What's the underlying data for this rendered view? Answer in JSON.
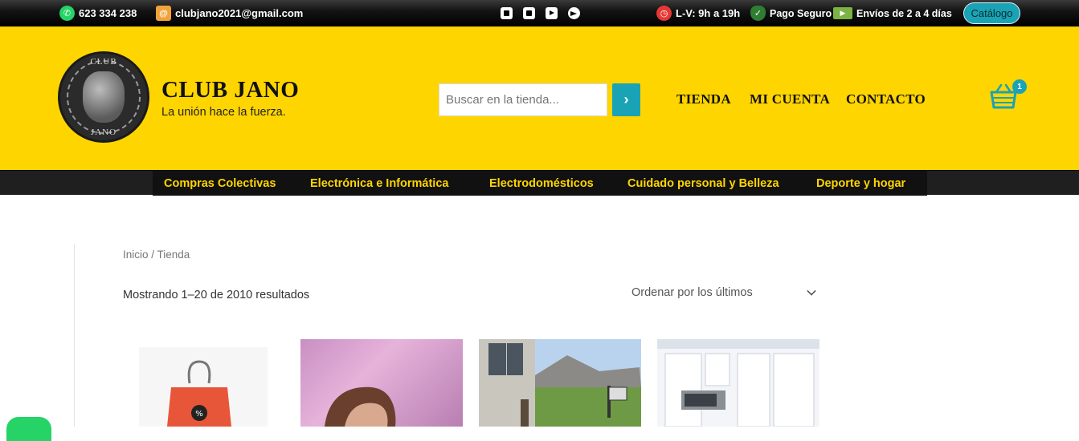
{
  "topbar": {
    "phone": "623 334 238",
    "email": "clubjano2021@gmail.com",
    "social_icons": [
      "instagram-icon",
      "facebook-icon",
      "youtube-icon",
      "telegram-icon"
    ],
    "hours": "L-V: 9h a 19h",
    "secure_payment": "Pago Seguro",
    "shipping": "Envíos de 2 a 4 días",
    "catalog_button": "Catálogo"
  },
  "header": {
    "site_title": "CLUB JANO",
    "tagline": "La unión hace la fuerza.",
    "logo_text_top": "CLUB",
    "logo_text_bottom": "JANO",
    "search_placeholder": "Buscar en la tienda...",
    "nav": [
      "TIENDA",
      "MI CUENTA",
      "CONTACTO"
    ],
    "cart_count": "1"
  },
  "categories": [
    "Compras Colectivas",
    "Electrónica e Informática",
    "Electrodomésticos",
    "Cuidado personal y Belleza",
    "Deporte y hogar"
  ],
  "main": {
    "breadcrumb": "Inicio / Tienda",
    "results_count": "Mostrando 1–20 de 2010 resultados",
    "orderby": "Ordenar por los últimos"
  },
  "colors": {
    "brand_yellow": "#ffd500",
    "accent_teal": "#1aa3b5",
    "topbar_black": "#141414",
    "category_text": "#ffd500"
  }
}
